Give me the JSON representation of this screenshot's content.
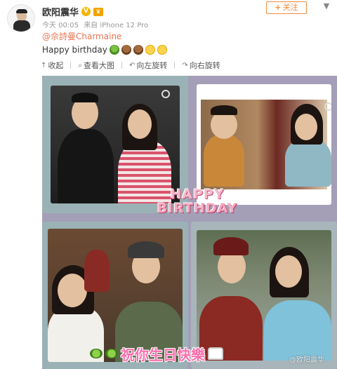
{
  "user": {
    "name": "欧阳震华",
    "follow_label": "关注",
    "follow_plus": "+"
  },
  "meta": {
    "time": "今天 00:05",
    "source": "来自 iPhone 12 Pro"
  },
  "post": {
    "mention": "@佘詩曼Charmaine",
    "text": "Happy birthday"
  },
  "toolbar": {
    "collapse": "收起",
    "view_large": "查看大图",
    "rotate_left": "向左旋转",
    "rotate_right": "向右旋转"
  },
  "image": {
    "banner_line1": "HAPPY",
    "banner_line2": "BIRTHDAY",
    "wish": "祝你生日快樂",
    "watermark": "@欧阳震华"
  },
  "icons": {
    "verified": "vip-badge-icon",
    "crown": "crown-badge-icon",
    "chevron": "chevron-down-icon"
  }
}
